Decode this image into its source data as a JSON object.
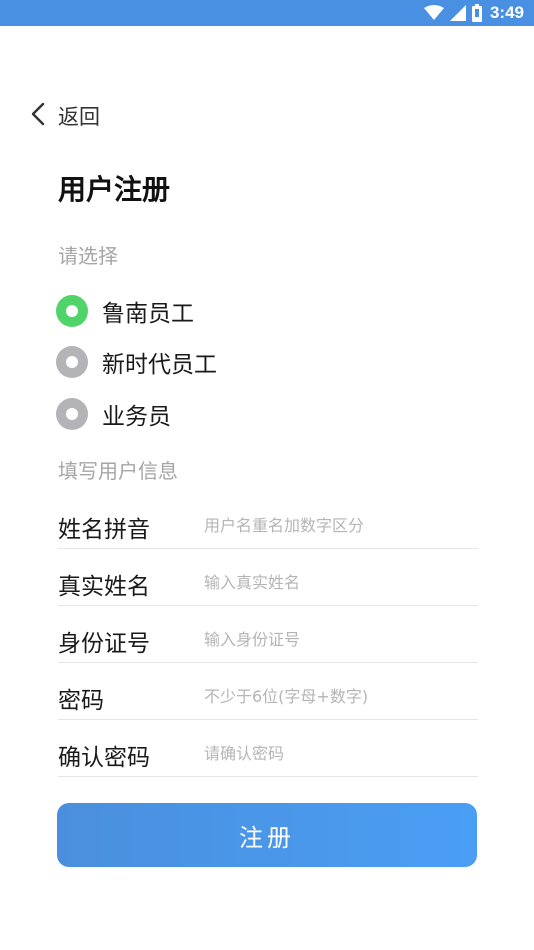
{
  "status_bar": {
    "time": "3:49",
    "icons": [
      "wifi-icon",
      "cell-signal-icon",
      "battery-icon"
    ]
  },
  "nav": {
    "back_label": "返回"
  },
  "title": "用户注册",
  "choose_section": {
    "label": "请选择",
    "options": [
      {
        "label": "鲁南员工",
        "selected": true
      },
      {
        "label": "新时代员工",
        "selected": false
      },
      {
        "label": "业务员",
        "selected": false
      }
    ]
  },
  "info_section": {
    "label": "填写用户信息",
    "fields": [
      {
        "label": "姓名拼音",
        "placeholder": "用户名重名加数字区分",
        "value": ""
      },
      {
        "label": "真实姓名",
        "placeholder": "输入真实姓名",
        "value": ""
      },
      {
        "label": "身份证号",
        "placeholder": "输入身份证号",
        "value": ""
      },
      {
        "label": "密码",
        "placeholder": "不少于6位(字母+数字)",
        "value": ""
      },
      {
        "label": "确认密码",
        "placeholder": "请确认密码",
        "value": ""
      }
    ]
  },
  "submit_label": "注册",
  "colors": {
    "status_bar": "#4a90e2",
    "radio_selected": "#4fd469",
    "radio_unselected": "#b3b3b8",
    "button": "#4a9ef5"
  }
}
